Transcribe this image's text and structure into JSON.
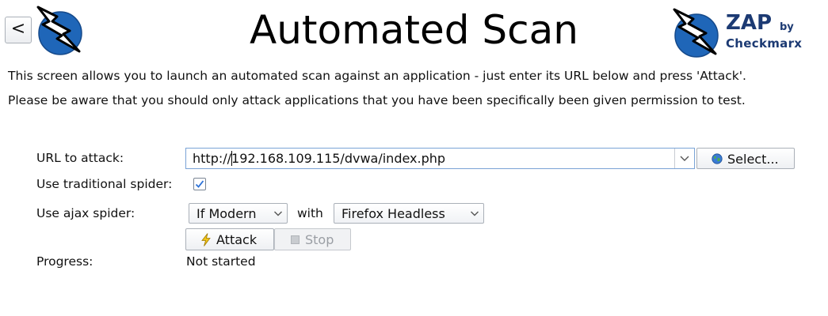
{
  "header": {
    "back_label": "<",
    "title": "Automated Scan",
    "brand": {
      "zap": "ZAP",
      "by": "by",
      "checkmarx": "Checkmarx"
    }
  },
  "description": {
    "line1": "This screen allows you to launch an automated scan against  an application - just enter its URL below and press 'Attack'.",
    "line2": "Please be aware that you should only attack applications that you have been specifically been given permission to test."
  },
  "form": {
    "url_label": "URL to attack:",
    "url_value": "http://192.168.109.115/dvwa/index.php",
    "select_label": "Select...",
    "traditional_spider_label": "Use traditional spider:",
    "traditional_spider_checked": true,
    "ajax_spider_label": "Use ajax spider:",
    "ajax_mode": "If Modern",
    "with_label": "with",
    "browser": "Firefox Headless",
    "attack_label": "Attack",
    "stop_label": "Stop",
    "progress_label": "Progress:",
    "progress_value": "Not started"
  },
  "icons": {
    "back": "chevron-left-icon",
    "logo": "zap-lightning-logo-icon",
    "globe": "globe-icon",
    "lightning": "lightning-bolt-icon",
    "stop": "stop-square-icon",
    "dropdown": "chevron-down-icon",
    "check": "checkmark-icon"
  },
  "colors": {
    "brand_blue": "#1c3a73",
    "logo_blue": "#1f66b8",
    "focus_border": "#7aa3d6",
    "check_blue": "#2f73d8",
    "lightning_yellow": "#f0c419"
  }
}
